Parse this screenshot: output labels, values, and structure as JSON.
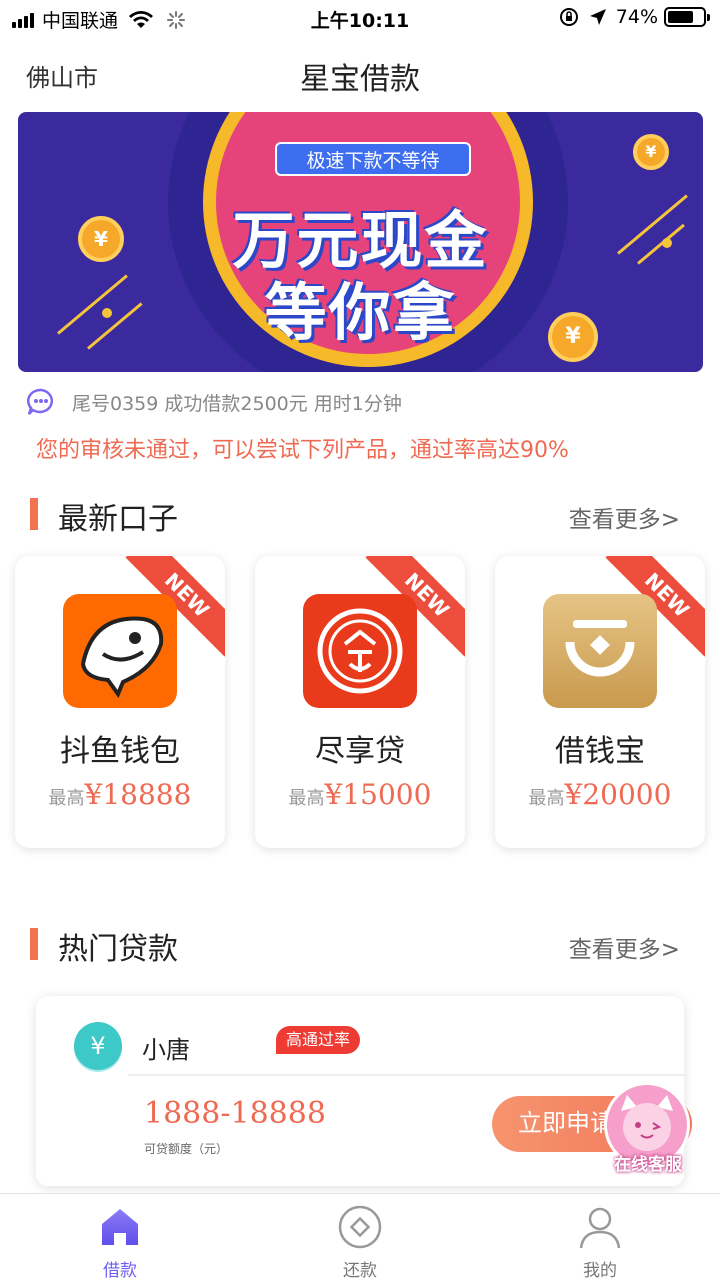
{
  "status_bar": {
    "carrier": "中国联通",
    "time": "上午10:11",
    "battery": "74%",
    "battery_level": 0.74
  },
  "header": {
    "city": "佛山市",
    "title": "星宝借款"
  },
  "banner": {
    "tag": "极速下款不等待",
    "line1": "万元现金",
    "line2": "等你拿",
    "coin_symbol": "¥"
  },
  "notice": {
    "icon": "chat-bubble-icon",
    "text": "尾号0359 成功借款2500元 用时1分钟"
  },
  "alert": "您的审核未通过，可以尝试下列产品，通过率高达90%",
  "section_new": {
    "title": "最新口子",
    "more": "查看更多>"
  },
  "products": [
    {
      "ribbon": "NEW",
      "name": "抖鱼钱包",
      "prefix": "最高",
      "amount": "¥18888",
      "icon": "shark-icon",
      "color": "#ff6a00"
    },
    {
      "ribbon": "NEW",
      "name": "尽享贷",
      "prefix": "最高",
      "amount": "¥15000",
      "icon": "seal-icon",
      "color": "#e93a1c"
    },
    {
      "ribbon": "NEW",
      "name": "借钱宝",
      "prefix": "最高",
      "amount": "¥20000",
      "icon": "coin-bowl-icon",
      "color": "#d9b06a"
    }
  ],
  "section_hot": {
    "title": "热门贷款",
    "more": "查看更多>"
  },
  "hot_loan": {
    "yen": "¥",
    "name": "小唐",
    "badge": "高通过率",
    "range": "1888-18888",
    "sub": "可贷额度（元）",
    "apply": "立即申请"
  },
  "service": {
    "label": "在线客服"
  },
  "tabs": [
    {
      "label": "借款",
      "icon": "home-icon",
      "active": true
    },
    {
      "label": "还款",
      "icon": "repay-icon",
      "active": false
    },
    {
      "label": "我的",
      "icon": "user-icon",
      "active": false
    }
  ],
  "colors": {
    "accent": "#6f5ff0",
    "highlight": "#ef6a52",
    "ribbon": "#ec4d3c"
  }
}
